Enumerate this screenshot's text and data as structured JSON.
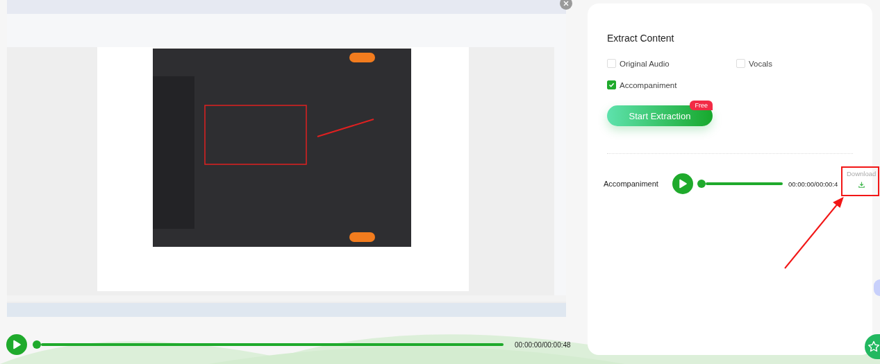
{
  "video_player": {
    "playing": false,
    "level": 0,
    "time": "00:00:00/00:00:48"
  },
  "extract_panel": {
    "title": "Extract Content",
    "options": [
      {
        "label": "Original Audio",
        "checked": false
      },
      {
        "label": "Vocals",
        "checked": false
      },
      {
        "label": "Accompaniment",
        "checked": true
      }
    ],
    "start_button": {
      "label": "Start Extraction",
      "badge": "Free"
    },
    "result": {
      "label": "Accompaniment",
      "playing": false,
      "level": 0,
      "time": "00:00:00/00:00:4",
      "download": "Download"
    }
  }
}
